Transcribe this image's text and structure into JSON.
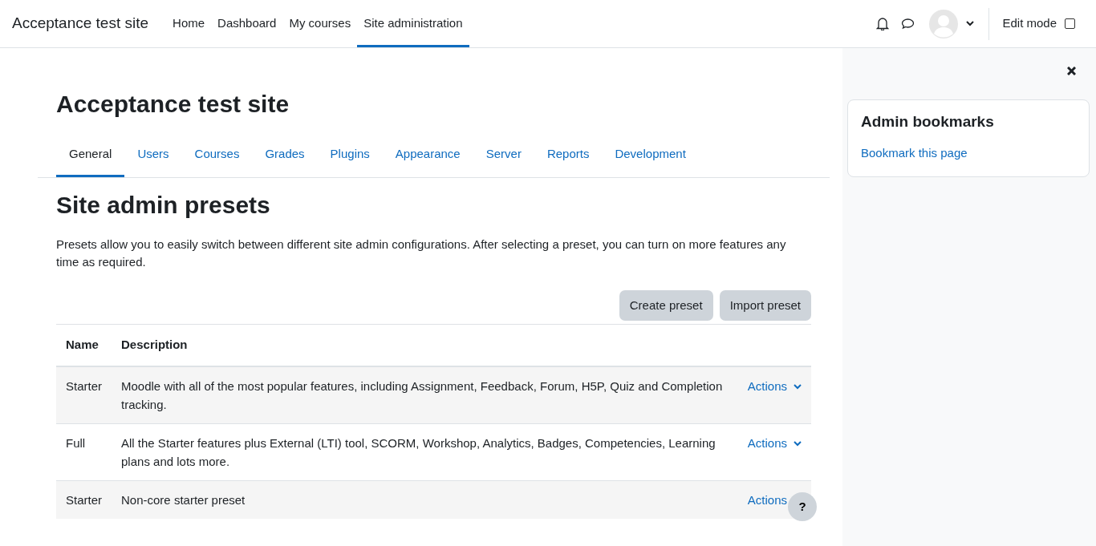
{
  "navbar": {
    "site_name": "Acceptance test site",
    "items": [
      {
        "label": "Home",
        "selected": false
      },
      {
        "label": "Dashboard",
        "selected": false
      },
      {
        "label": "My courses",
        "selected": false
      },
      {
        "label": "Site administration",
        "selected": true
      }
    ],
    "edit_mode": {
      "label": "Edit mode",
      "on": false
    }
  },
  "page_title": "Acceptance test site",
  "tabs": [
    {
      "label": "General",
      "selected": true
    },
    {
      "label": "Users",
      "selected": false
    },
    {
      "label": "Courses",
      "selected": false
    },
    {
      "label": "Grades",
      "selected": false
    },
    {
      "label": "Plugins",
      "selected": false
    },
    {
      "label": "Appearance",
      "selected": false
    },
    {
      "label": "Server",
      "selected": false
    },
    {
      "label": "Reports",
      "selected": false
    },
    {
      "label": "Development",
      "selected": false
    }
  ],
  "heading": "Site admin presets",
  "intro": "Presets allow you to easily switch between different site admin configurations. After selecting a preset, you can turn on more features any time as required.",
  "buttons": [
    "Create preset",
    "Import preset"
  ],
  "table": {
    "columns": [
      "Name",
      "Description"
    ],
    "rows": [
      {
        "name": "Starter",
        "description": "Moodle with all of the most popular features, including Assignment, Feedback, Forum, H5P, Quiz and Completion tracking.",
        "action": "Actions",
        "caret_shown": true
      },
      {
        "name": "Full",
        "description": "All the Starter features plus External (LTI) tool, SCORM, Workshop, Analytics, Badges, Competencies, Learning plans and lots more.",
        "action": "Actions",
        "caret_shown": true
      },
      {
        "name": "Starter",
        "description": "Non-core starter preset",
        "action": "Actions",
        "caret_shown": false
      }
    ]
  },
  "drawer": {
    "title": "Admin bookmarks",
    "link": "Bookmark this page"
  },
  "help_button": "?"
}
